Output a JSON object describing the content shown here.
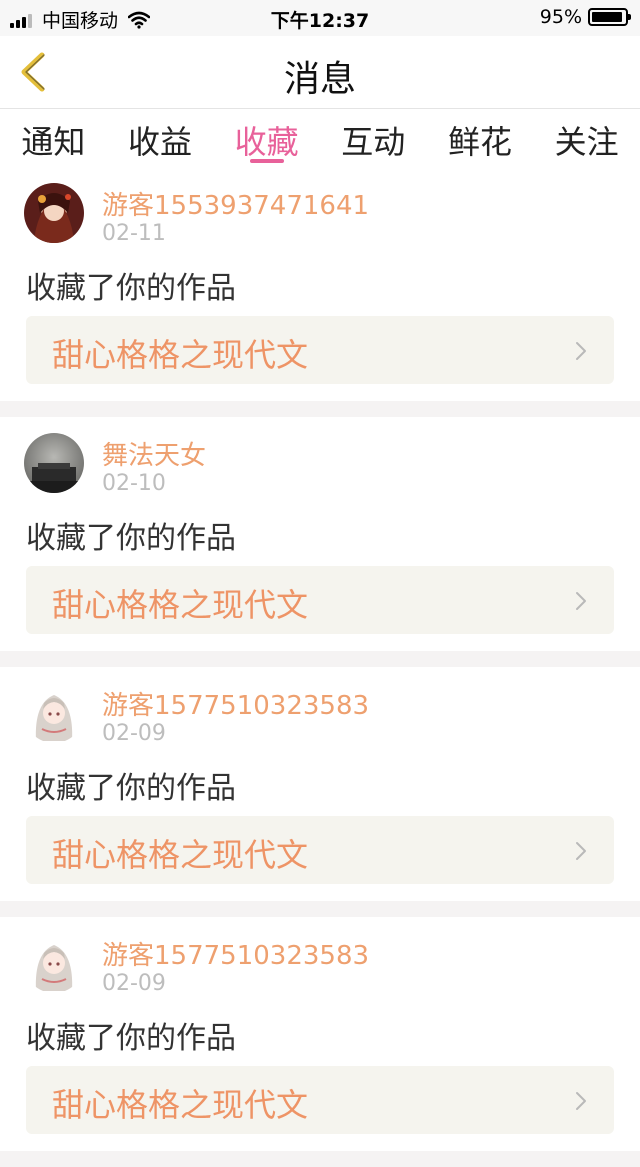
{
  "status_bar": {
    "carrier": "中国移动",
    "time": "下午12:37",
    "battery_percent": "95%",
    "battery_level": 0.95
  },
  "header": {
    "title": "消息",
    "back_icon": "chevron-left-icon"
  },
  "tabs": [
    {
      "label": "通知",
      "active": false
    },
    {
      "label": "收益",
      "active": false
    },
    {
      "label": "收藏",
      "active": true
    },
    {
      "label": "互动",
      "active": false
    },
    {
      "label": "鲜花",
      "active": false
    },
    {
      "label": "关注",
      "active": false
    }
  ],
  "colors": {
    "accent_pink": "#e8619a",
    "username_orange": "#eea06f",
    "work_title_orange": "#ee9466"
  },
  "items": [
    {
      "username": "游客1553937471641",
      "date": "02-11",
      "action": "收藏了你的作品",
      "work_title": "甜心格格之现代文"
    },
    {
      "username": "舞法天女",
      "date": "02-10",
      "action": "收藏了你的作品",
      "work_title": "甜心格格之现代文"
    },
    {
      "username": "游客1577510323583",
      "date": "02-09",
      "action": "收藏了你的作品",
      "work_title": "甜心格格之现代文"
    },
    {
      "username": "游客1577510323583",
      "date": "02-09",
      "action": "收藏了你的作品",
      "work_title": "甜心格格之现代文"
    }
  ]
}
